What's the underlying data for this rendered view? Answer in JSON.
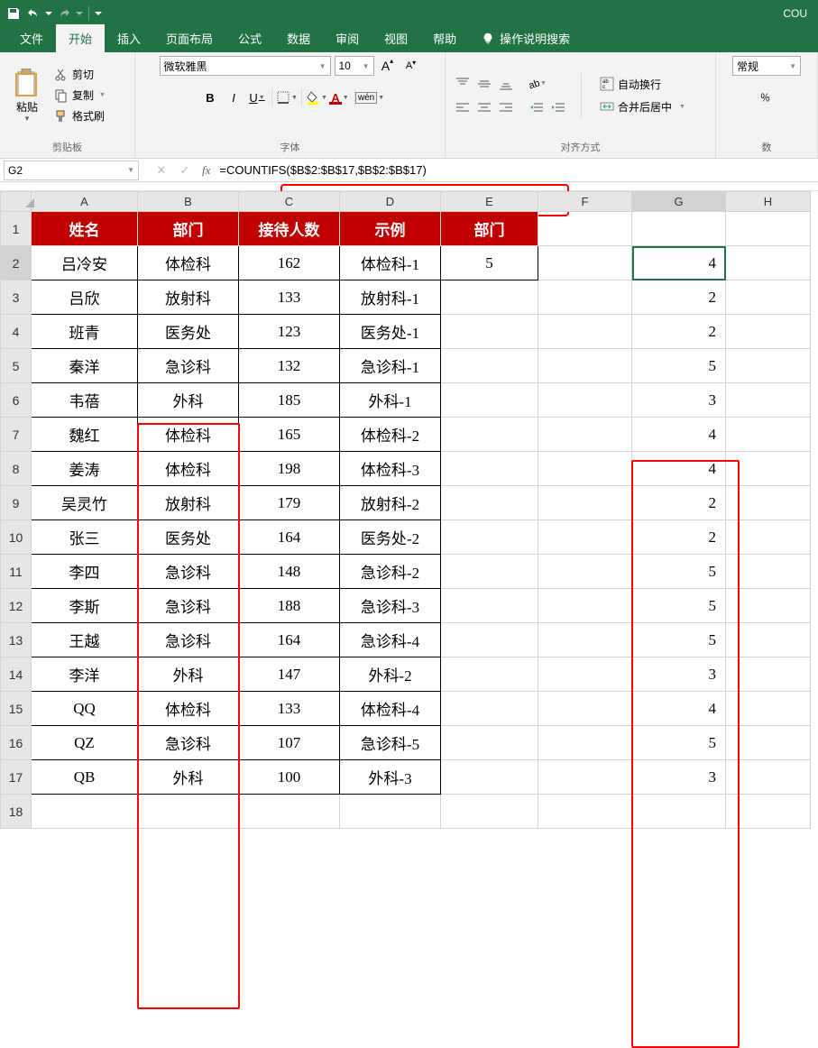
{
  "titlebar": {
    "title": "COU"
  },
  "tabs": {
    "file": "文件",
    "home": "开始",
    "insert": "插入",
    "layout": "页面布局",
    "formulas": "公式",
    "data": "数据",
    "review": "审阅",
    "view": "视图",
    "help": "帮助",
    "tell": "操作说明搜索"
  },
  "ribbon": {
    "clipboard": {
      "paste": "粘贴",
      "cut": "剪切",
      "copy": "复制",
      "format_painter": "格式刷",
      "group": "剪贴板"
    },
    "font": {
      "name": "微软雅黑",
      "size": "10",
      "group": "字体"
    },
    "align": {
      "wrap": "自动换行",
      "merge": "合并后居中",
      "group": "对齐方式"
    },
    "number": {
      "format": "常规",
      "group": "数"
    }
  },
  "fx": {
    "name_box": "G2",
    "formula": "=COUNTIFS($B$2:$B$17,$B$2:$B$17)"
  },
  "columns": [
    "A",
    "B",
    "C",
    "D",
    "E",
    "F",
    "G",
    "H"
  ],
  "headers": {
    "A": "姓名",
    "B": "部门",
    "C": "接待人数",
    "D": "示例",
    "E": "部门"
  },
  "rows": [
    {
      "A": "吕冷安",
      "B": "体检科",
      "C": "162",
      "D": "体检科-1",
      "E": "5",
      "G": "4"
    },
    {
      "A": "吕欣",
      "B": "放射科",
      "C": "133",
      "D": "放射科-1",
      "E": "",
      "G": "2"
    },
    {
      "A": "班青",
      "B": "医务处",
      "C": "123",
      "D": "医务处-1",
      "E": "",
      "G": "2"
    },
    {
      "A": "秦洋",
      "B": "急诊科",
      "C": "132",
      "D": "急诊科-1",
      "E": "",
      "G": "5"
    },
    {
      "A": "韦蓓",
      "B": "外科",
      "C": "185",
      "D": "外科-1",
      "E": "",
      "G": "3"
    },
    {
      "A": "魏红",
      "B": "体检科",
      "C": "165",
      "D": "体检科-2",
      "E": "",
      "G": "4"
    },
    {
      "A": "姜涛",
      "B": "体检科",
      "C": "198",
      "D": "体检科-3",
      "E": "",
      "G": "4"
    },
    {
      "A": "吴灵竹",
      "B": "放射科",
      "C": "179",
      "D": "放射科-2",
      "E": "",
      "G": "2"
    },
    {
      "A": "张三",
      "B": "医务处",
      "C": "164",
      "D": "医务处-2",
      "E": "",
      "G": "2"
    },
    {
      "A": "李四",
      "B": "急诊科",
      "C": "148",
      "D": "急诊科-2",
      "E": "",
      "G": "5"
    },
    {
      "A": "李斯",
      "B": "急诊科",
      "C": "188",
      "D": "急诊科-3",
      "E": "",
      "G": "5"
    },
    {
      "A": "王越",
      "B": "急诊科",
      "C": "164",
      "D": "急诊科-4",
      "E": "",
      "G": "5"
    },
    {
      "A": "李洋",
      "B": "外科",
      "C": "147",
      "D": "外科-2",
      "E": "",
      "G": "3"
    },
    {
      "A": "QQ",
      "B": "体检科",
      "C": "133",
      "D": "体检科-4",
      "E": "",
      "G": "4"
    },
    {
      "A": "QZ",
      "B": "急诊科",
      "C": "107",
      "D": "急诊科-5",
      "E": "",
      "G": "5"
    },
    {
      "A": "QB",
      "B": "外科",
      "C": "100",
      "D": "外科-3",
      "E": "",
      "G": "3"
    }
  ]
}
